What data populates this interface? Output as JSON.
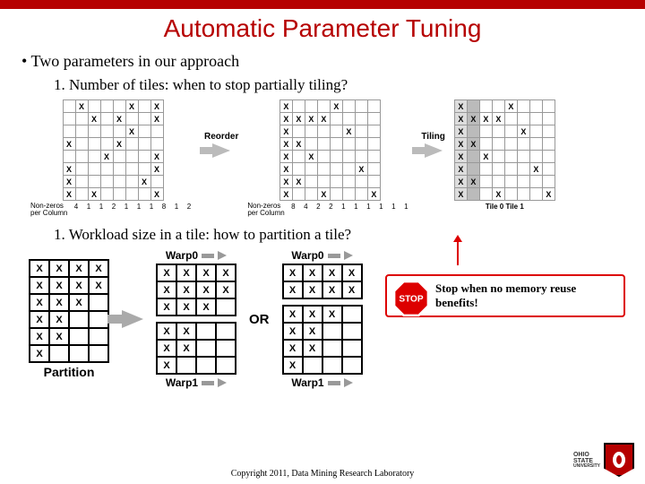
{
  "title": "Automatic Parameter Tuning",
  "bullet_main": "Two parameters in our approach",
  "item1": "1.   Number of tiles: when to stop partially tiling?",
  "item2": "1.   Workload size in a tile: how to partition a tile?",
  "diagram1": {
    "reorder_label": "Reorder",
    "tiling_label": "Tiling",
    "nonzeros_label": "Non-zeros\nper Column",
    "matrixA": [
      [
        "",
        "X",
        "",
        "",
        "",
        "X",
        "",
        "X"
      ],
      [
        "",
        "",
        "X",
        "",
        "X",
        "",
        "",
        "X"
      ],
      [
        "",
        "",
        "",
        "",
        "",
        "X",
        "",
        ""
      ],
      [
        "X",
        "",
        "",
        "",
        "X",
        "",
        "",
        ""
      ],
      [
        "",
        "",
        "",
        "X",
        "",
        "",
        "",
        "X"
      ],
      [
        "X",
        "",
        "",
        "",
        "",
        "",
        "",
        "X"
      ],
      [
        "X",
        "",
        "",
        "",
        "",
        "",
        "X",
        ""
      ],
      [
        "X",
        "",
        "X",
        "",
        "",
        "",
        "",
        "X"
      ]
    ],
    "nzA": [
      "4",
      "1",
      "1",
      "2",
      "1",
      "1",
      "1",
      "8",
      "1",
      "2"
    ],
    "matrixB": [
      [
        "X",
        "",
        "",
        "",
        "X",
        "",
        "",
        ""
      ],
      [
        "X",
        "X",
        "X",
        "X",
        "",
        "",
        "",
        ""
      ],
      [
        "X",
        "",
        "",
        "",
        "",
        "X",
        "",
        ""
      ],
      [
        "X",
        "X",
        "",
        "",
        "",
        "",
        "",
        ""
      ],
      [
        "X",
        "",
        "X",
        "",
        "",
        "",
        "",
        ""
      ],
      [
        "X",
        "",
        "",
        "",
        "",
        "",
        "X",
        ""
      ],
      [
        "X",
        "X",
        "",
        "",
        "",
        "",
        "",
        ""
      ],
      [
        "X",
        "",
        "",
        "X",
        "",
        "",
        "",
        "X"
      ]
    ],
    "nzB": [
      "8",
      "4",
      "2",
      "2",
      "1",
      "1",
      "1",
      "1",
      "1",
      "1"
    ],
    "matrixC": [
      [
        "X",
        "",
        "",
        "",
        "X",
        "",
        "",
        ""
      ],
      [
        "X",
        "X",
        "X",
        "X",
        "",
        "",
        "",
        ""
      ],
      [
        "X",
        "",
        "",
        "",
        "",
        "X",
        "",
        ""
      ],
      [
        "X",
        "X",
        "",
        "",
        "",
        "",
        "",
        ""
      ],
      [
        "X",
        "",
        "X",
        "",
        "",
        "",
        "",
        ""
      ],
      [
        "X",
        "",
        "",
        "",
        "",
        "",
        "X",
        ""
      ],
      [
        "X",
        "X",
        "",
        "",
        "",
        "",
        "",
        ""
      ],
      [
        "X",
        "",
        "",
        "X",
        "",
        "",
        "",
        "X"
      ]
    ],
    "tile0_label": "Tile 0",
    "tile1_label": "Tile 1"
  },
  "callout_text": "Stop when no memory reuse benefits!",
  "stop_label": "STOP",
  "diagram2": {
    "partition_label": "Partition",
    "warp0": "Warp0",
    "warp1": "Warp1",
    "or_label": "OR",
    "left_matrix": [
      [
        "X",
        "X",
        "X",
        "X"
      ],
      [
        "X",
        "X",
        "X",
        "X"
      ],
      [
        "X",
        "X",
        "X",
        ""
      ],
      [
        "X",
        "X",
        "",
        ""
      ],
      [
        "X",
        "X",
        "",
        ""
      ],
      [
        "X",
        "",
        "",
        ""
      ]
    ],
    "right_top_A": [
      [
        "X",
        "X",
        "X",
        "X"
      ],
      [
        "X",
        "X",
        "X",
        "X"
      ],
      [
        "X",
        "X",
        "X",
        ""
      ]
    ],
    "right_bot_A": [
      [
        "X",
        "X",
        "",
        ""
      ],
      [
        "X",
        "X",
        "",
        ""
      ],
      [
        "X",
        "",
        "",
        ""
      ]
    ],
    "right_top_B": [
      [
        "X",
        "X",
        "X",
        "X"
      ],
      [
        "X",
        "X",
        "X",
        "X"
      ]
    ],
    "right_bot_B": [
      [
        "X",
        "X",
        "X",
        ""
      ],
      [
        "X",
        "X",
        "",
        ""
      ],
      [
        "X",
        "X",
        "",
        ""
      ],
      [
        "X",
        "",
        "",
        ""
      ]
    ]
  },
  "footer": "Copyright 2011, Data Mining Research Laboratory",
  "logo": {
    "school": "OHIO",
    "state": "STATE",
    "univ": "UNIVERSITY"
  }
}
